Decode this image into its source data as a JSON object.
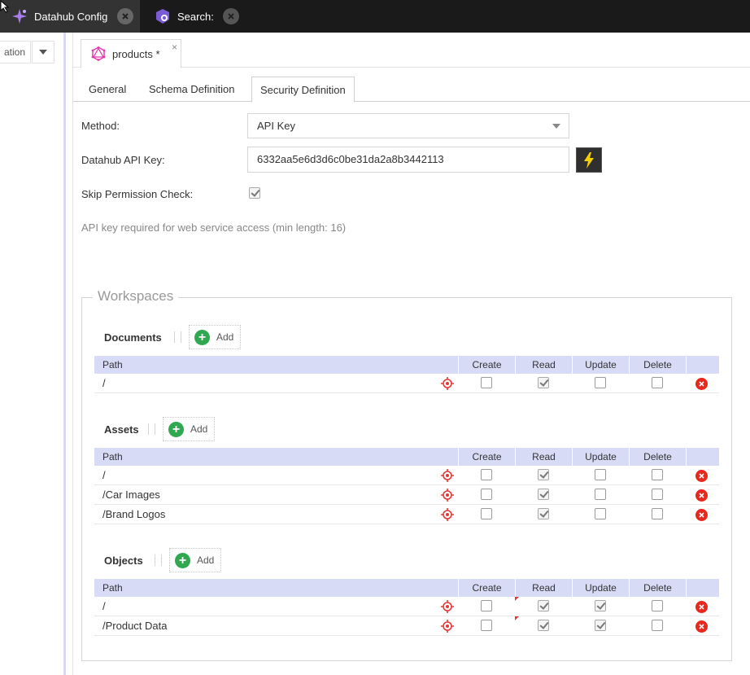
{
  "top_tabs": [
    {
      "label": "Datahub Config"
    },
    {
      "label": "Search:"
    }
  ],
  "left_panel": {
    "field_text": "ation"
  },
  "doc_tab": {
    "label": "products *",
    "close": "×"
  },
  "sub_tabs": [
    {
      "label": "General"
    },
    {
      "label": "Schema Definition"
    },
    {
      "label": "Security Definition",
      "active": true
    }
  ],
  "form": {
    "method_label": "Method:",
    "method_value": "API Key",
    "apikey_label": "Datahub API Key:",
    "apikey_value": "6332aa5e6d3d6c0be31da2a8b3442113",
    "skip_label": "Skip Permission Check:",
    "skip_checked": true,
    "hint": "API key required for web service access (min length: 16)"
  },
  "workspaces": {
    "legend": "Workspaces",
    "add_label": "Add",
    "columns": {
      "path": "Path",
      "create": "Create",
      "read": "Read",
      "update": "Update",
      "delete": "Delete"
    },
    "documents": {
      "title": "Documents",
      "rows": [
        {
          "path": "/",
          "create": false,
          "read": true,
          "update": false,
          "delete": false
        }
      ]
    },
    "assets": {
      "title": "Assets",
      "rows": [
        {
          "path": "/",
          "create": false,
          "read": true,
          "update": false,
          "delete": false
        },
        {
          "path": "/Car Images",
          "create": false,
          "read": true,
          "update": false,
          "delete": false
        },
        {
          "path": "/Brand Logos",
          "create": false,
          "read": true,
          "update": false,
          "delete": false
        }
      ]
    },
    "objects": {
      "title": "Objects",
      "rows": [
        {
          "path": "/",
          "create": false,
          "read": true,
          "update": true,
          "delete": false
        },
        {
          "path": "/Product Data",
          "create": false,
          "read": true,
          "update": true,
          "delete": false
        }
      ]
    }
  },
  "colors": {
    "accent_green": "#2fa84f",
    "delete_red": "#e8271d",
    "header_blue": "#d7dbf6",
    "target_red": "#e53935"
  }
}
